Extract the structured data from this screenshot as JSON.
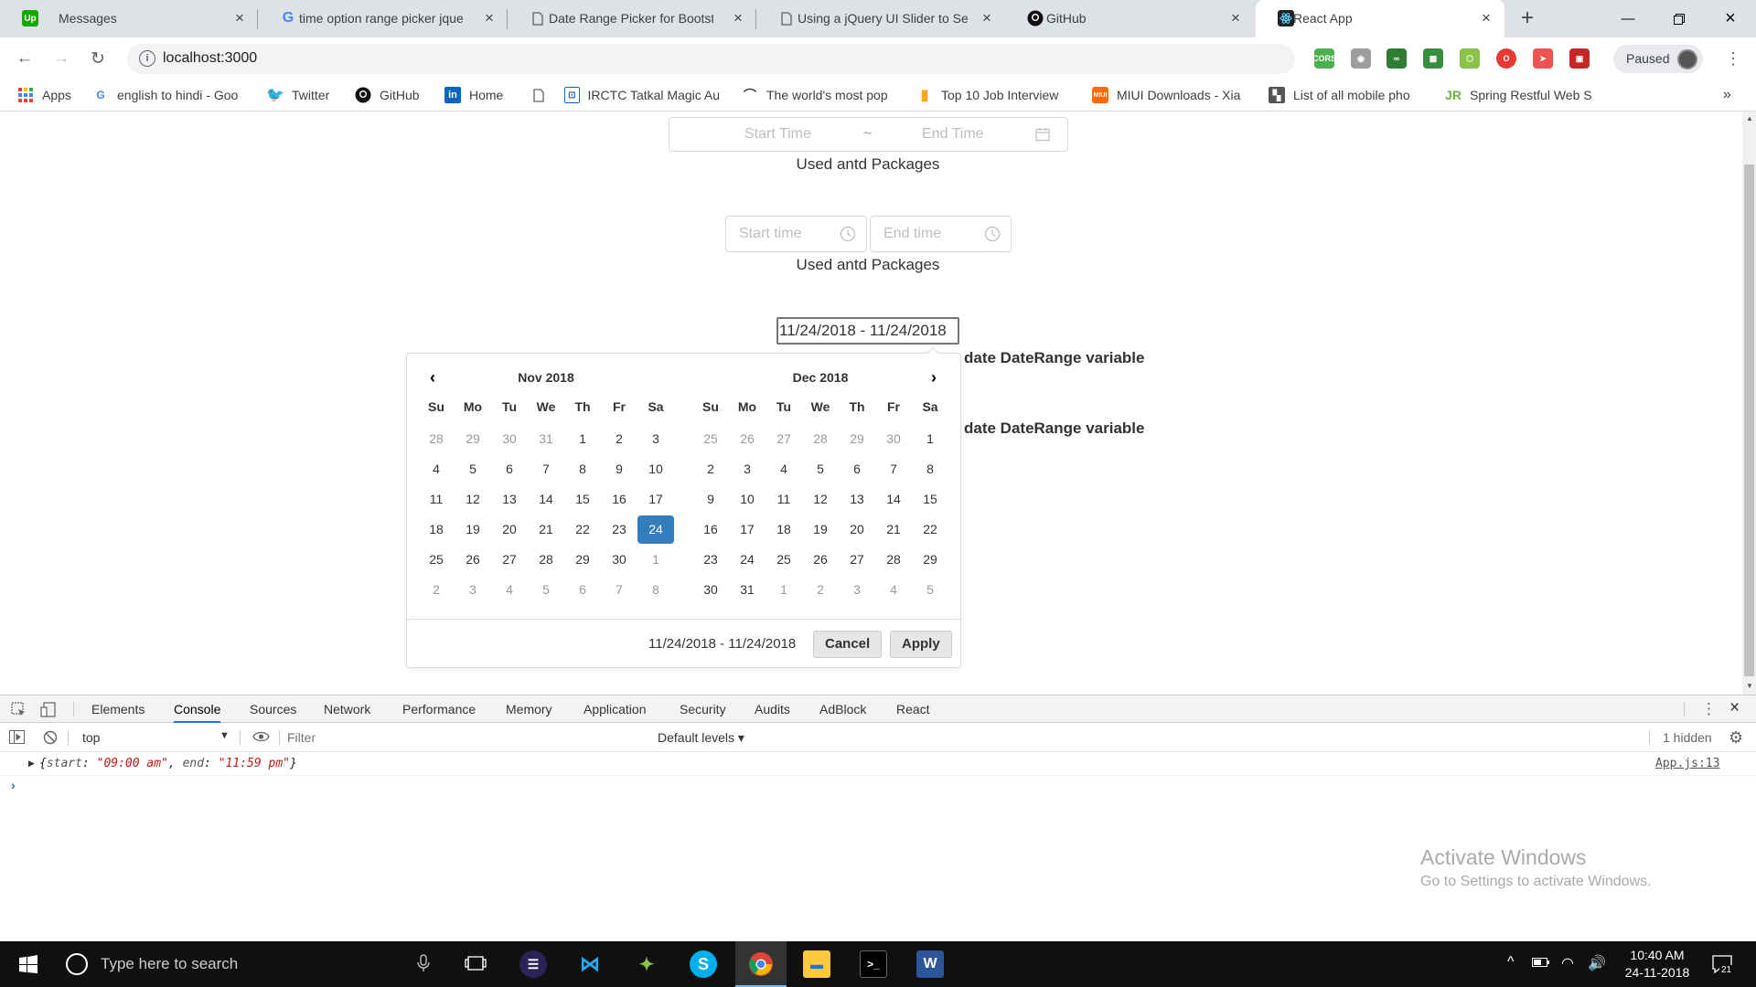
{
  "browser": {
    "tabs": [
      {
        "title": "Messages"
      },
      {
        "title": "time option range picker jque"
      },
      {
        "title": "Date Range Picker for Bootst"
      },
      {
        "title": "Using a jQuery UI Slider to Se"
      },
      {
        "title": "GitHub"
      },
      {
        "title": "React App"
      }
    ],
    "url": "localhost:3000",
    "paused_label": "Paused",
    "bookmarks": [
      {
        "label": "Apps"
      },
      {
        "label": "english to hindi - Goo"
      },
      {
        "label": "Twitter"
      },
      {
        "label": "GitHub"
      },
      {
        "label": "Home"
      },
      {
        "label": "IRCTC Tatkal Magic Au"
      },
      {
        "label": "The world's most pop"
      },
      {
        "label": "Top 10 Job Interview"
      },
      {
        "label": "MIUI Downloads - Xia"
      },
      {
        "label": "List of all mobile pho"
      },
      {
        "label": "Spring Restful Web S"
      }
    ]
  },
  "page": {
    "range_start_placeholder": "Start Time",
    "range_separator": "~",
    "range_end_placeholder": "End Time",
    "caption1": "Used antd Packages",
    "time_start_placeholder": "Start time",
    "time_end_placeholder": "End time",
    "caption2": "Used antd Packages",
    "daterange_value": "11/24/2018 - 11/24/2018",
    "behind_text1": "date DateRange variable",
    "behind_text2": "date DateRange variable"
  },
  "daterangepicker": {
    "left": {
      "month": "Nov 2018",
      "weekdays": [
        "Su",
        "Mo",
        "Tu",
        "We",
        "Th",
        "Fr",
        "Sa"
      ],
      "weeks": [
        [
          "28",
          "29",
          "30",
          "31",
          "1",
          "2",
          "3"
        ],
        [
          "4",
          "5",
          "6",
          "7",
          "8",
          "9",
          "10"
        ],
        [
          "11",
          "12",
          "13",
          "14",
          "15",
          "16",
          "17"
        ],
        [
          "18",
          "19",
          "20",
          "21",
          "22",
          "23",
          "24"
        ],
        [
          "25",
          "26",
          "27",
          "28",
          "29",
          "30",
          "1"
        ],
        [
          "2",
          "3",
          "4",
          "5",
          "6",
          "7",
          "8"
        ]
      ]
    },
    "right": {
      "month": "Dec 2018",
      "weekdays": [
        "Su",
        "Mo",
        "Tu",
        "We",
        "Th",
        "Fr",
        "Sa"
      ],
      "weeks": [
        [
          "25",
          "26",
          "27",
          "28",
          "29",
          "30",
          "1"
        ],
        [
          "2",
          "3",
          "4",
          "5",
          "6",
          "7",
          "8"
        ],
        [
          "9",
          "10",
          "11",
          "12",
          "13",
          "14",
          "15"
        ],
        [
          "16",
          "17",
          "18",
          "19",
          "20",
          "21",
          "22"
        ],
        [
          "23",
          "24",
          "25",
          "26",
          "27",
          "28",
          "29"
        ],
        [
          "30",
          "31",
          "1",
          "2",
          "3",
          "4",
          "5"
        ]
      ]
    },
    "selected_label": "11/24/2018 - 11/24/2018",
    "cancel_label": "Cancel",
    "apply_label": "Apply",
    "active_color": "#357ebd"
  },
  "devtools": {
    "tabs": [
      "Elements",
      "Console",
      "Sources",
      "Network",
      "Performance",
      "Memory",
      "Application",
      "Security",
      "Audits",
      "AdBlock",
      "React"
    ],
    "active_tab": "Console",
    "context": "top",
    "filter_placeholder": "Filter",
    "levels": "Default levels ▾",
    "hidden": "1 hidden",
    "log": {
      "open": "{",
      "k1": "start",
      "v1": "\"09:00 am\"",
      "k2": "end",
      "v2": "\"11:59 pm\"",
      "close": "}",
      "source": "App.js:13"
    }
  },
  "watermark": {
    "title": "Activate Windows",
    "subtitle": "Go to Settings to activate Windows."
  },
  "taskbar": {
    "search_placeholder": "Type here to search",
    "time": "10:40 AM",
    "date": "24-11-2018",
    "notifications": "21"
  }
}
